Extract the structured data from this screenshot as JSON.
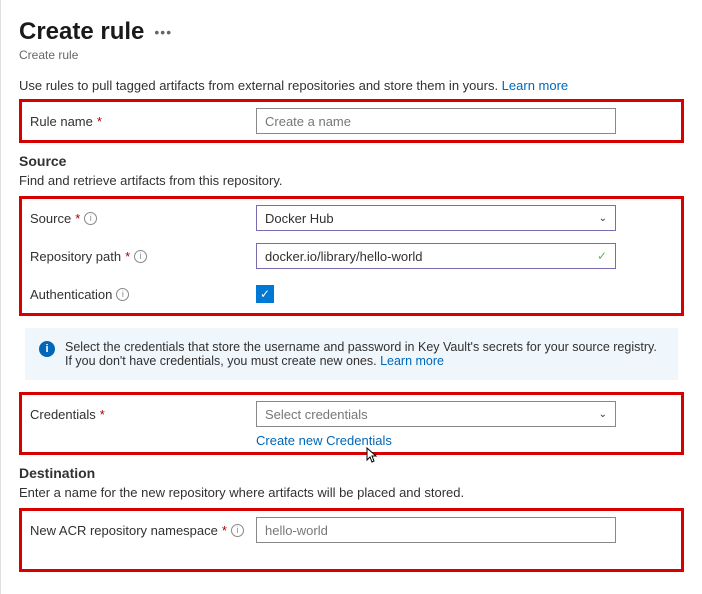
{
  "header": {
    "title": "Create rule",
    "subtitle": "Create rule"
  },
  "intro": {
    "text": "Use rules to pull tagged artifacts from external repositories and store them in yours. ",
    "learn_more": "Learn more"
  },
  "rule_name": {
    "label": "Rule name",
    "placeholder": "Create a name",
    "value": ""
  },
  "source_section": {
    "heading": "Source",
    "subheading": "Find and retrieve artifacts from this repository."
  },
  "source": {
    "label": "Source",
    "value": "Docker Hub"
  },
  "repo_path": {
    "label": "Repository path",
    "value": "docker.io/library/hello-world"
  },
  "auth": {
    "label": "Authentication",
    "checked": true
  },
  "infobox": {
    "text": "Select the credentials that store the username and password in Key Vault's secrets for your source registry. If you don't have credentials, you must create new ones. ",
    "learn_more": "Learn more"
  },
  "credentials": {
    "label": "Credentials",
    "placeholder": "Select credentials",
    "create_link": "Create new Credentials"
  },
  "destination_section": {
    "heading": "Destination",
    "subheading": "Enter a name for the new repository where artifacts will be placed and stored."
  },
  "namespace": {
    "label": "New ACR repository namespace",
    "placeholder": "hello-world",
    "value": ""
  }
}
